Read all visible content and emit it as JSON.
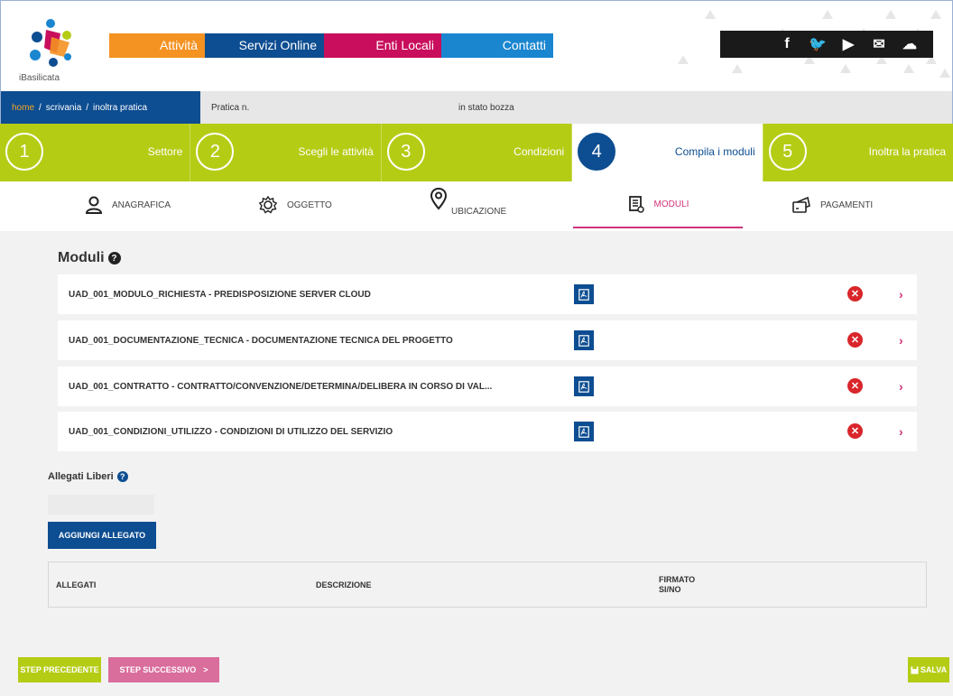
{
  "colors": {
    "brand_blue": "#0d4d91",
    "lime": "#b5cc15",
    "magenta": "#d0347a",
    "error_red": "#d9262b"
  },
  "logo": {
    "text": "iBasilicata"
  },
  "nav": [
    {
      "label": "Attività",
      "color": "#f49222",
      "width": 106
    },
    {
      "label": "Servizi Online",
      "color": "#0d4d91",
      "width": 132
    },
    {
      "label": "Enti Locali",
      "color": "#c80e5c",
      "width": 130
    },
    {
      "label": "Contatti",
      "color": "#1a86d0",
      "width": 124
    }
  ],
  "social": [
    {
      "name": "facebook-icon",
      "glyph": "f"
    },
    {
      "name": "twitter-icon",
      "glyph": "🐦"
    },
    {
      "name": "youtube-icon",
      "glyph": "▶"
    },
    {
      "name": "mail-icon",
      "glyph": "✉"
    },
    {
      "name": "cloud-icon",
      "glyph": "☁"
    }
  ],
  "breadcrumb": {
    "home": "home",
    "scrivania": "scrivania",
    "current": "inoltra pratica",
    "sep": "/"
  },
  "pratica": {
    "label": "Pratica n.",
    "status": "in stato bozza"
  },
  "steps": [
    {
      "num": "1",
      "label": "Settore",
      "active": false
    },
    {
      "num": "2",
      "label": "Scegli le attività",
      "active": false
    },
    {
      "num": "3",
      "label": "Condizioni",
      "active": false
    },
    {
      "num": "4",
      "label": "Compila i moduli",
      "active": true
    },
    {
      "num": "5",
      "label": "Inoltra la pratica",
      "active": false
    }
  ],
  "tabs": {
    "anagrafica": "ANAGRAFICA",
    "oggetto": "OGGETTO",
    "ubicazione": "UBICAZIONE",
    "moduli": "MODULI",
    "pagamenti": "PAGAMENTI"
  },
  "moduli": {
    "title": "Moduli",
    "help": "?",
    "items": [
      {
        "name": "UAD_001_MODULO_RICHIESTA - PREDISPOSIZIONE SERVER CLOUD"
      },
      {
        "name": "UAD_001_DOCUMENTAZIONE_TECNICA - DOCUMENTAZIONE TECNICA DEL PROGETTO"
      },
      {
        "name": "UAD_001_CONTRATTO - CONTRATTO/CONVENZIONE/DETERMINA/DELIBERA IN CORSO DI VAL..."
      },
      {
        "name": "UAD_001_CONDIZIONI_UTILIZZO - CONDIZIONI DI UTILIZZO DEL SERVIZIO"
      }
    ],
    "error_glyph": "✕",
    "chevron": "›"
  },
  "allegati": {
    "title": "Allegati Liberi",
    "help": "?",
    "add_button": "AGGIUNGI ALLEGATO",
    "headers": {
      "allegati": "ALLEGATI",
      "descrizione": "DESCRIZIONE",
      "firmato": "FIRMATO",
      "sino": "SI/NO"
    }
  },
  "footer": {
    "prev": "STEP PRECEDENTE",
    "next": "STEP SUCCESSIVO",
    "next_arrow": ">",
    "save": "SALVA"
  }
}
